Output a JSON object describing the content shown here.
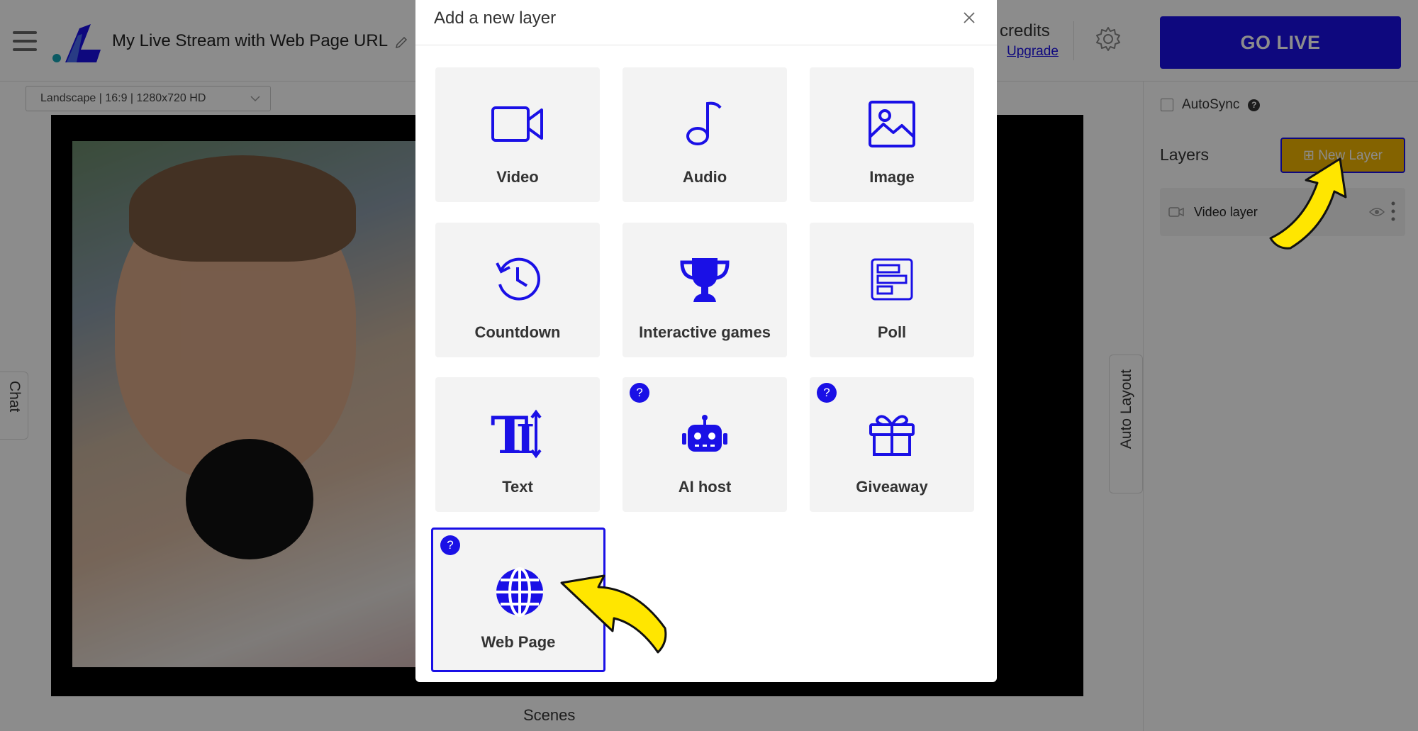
{
  "app": {
    "stream_title": "My Live Stream with Web Page URL",
    "credits_label": "credits",
    "upgrade_label": "Upgrade",
    "go_live_label": "GO LIVE",
    "resolution": "Landscape | 16:9 | 1280x720 HD",
    "chat_label": "Chat",
    "auto_layout_label": "Auto Layout",
    "scenes_label": "Scenes"
  },
  "right_panel": {
    "autosync_label": "AutoSync",
    "layers_title": "Layers",
    "new_layer_label": "New Layer",
    "layers": [
      {
        "label": "Video layer",
        "icon": "camera-icon"
      }
    ]
  },
  "modal": {
    "title": "Add a new layer",
    "tiles": [
      {
        "label": "Video",
        "icon": "video-camera-icon",
        "help": false
      },
      {
        "label": "Audio",
        "icon": "music-note-icon",
        "help": false
      },
      {
        "label": "Image",
        "icon": "image-icon",
        "help": false
      },
      {
        "label": "Countdown",
        "icon": "clock-history-icon",
        "help": false
      },
      {
        "label": "Interactive games",
        "icon": "trophy-icon",
        "help": false
      },
      {
        "label": "Poll",
        "icon": "poll-bars-icon",
        "help": false
      },
      {
        "label": "Text",
        "icon": "text-height-icon",
        "help": false
      },
      {
        "label": "AI host",
        "icon": "robot-icon",
        "help": true
      },
      {
        "label": "Giveaway",
        "icon": "gift-icon",
        "help": true
      },
      {
        "label": "Web Page",
        "icon": "globe-icon",
        "help": true,
        "selected": true
      }
    ],
    "help_glyph": "?"
  },
  "colors": {
    "accent_blue": "#1a10e6",
    "new_layer_yellow": "#f0b400",
    "annotation_arrow": "#ffe600"
  }
}
